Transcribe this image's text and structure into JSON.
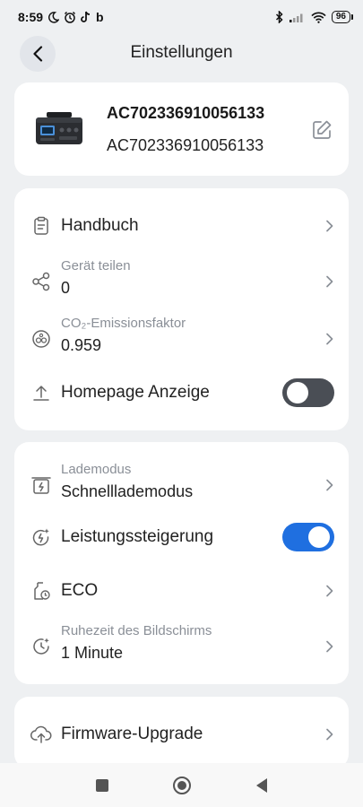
{
  "status_bar": {
    "time": "8:59",
    "notification_icons": [
      "moon-icon",
      "alarm-icon",
      "tiktok-icon",
      "b-icon"
    ],
    "b_label": "b",
    "battery": "96"
  },
  "header": {
    "title": "Einstellungen"
  },
  "device": {
    "name": "AC702336910056133",
    "serial": "AC702336910056133"
  },
  "section1": {
    "manual": {
      "title": "Handbuch"
    },
    "share": {
      "label": "Gerät teilen",
      "value": "0"
    },
    "co2": {
      "label": "CO₂-Emissionsfaktor",
      "value": "0.959"
    },
    "homepage": {
      "title": "Homepage Anzeige",
      "toggle": "off"
    }
  },
  "section2": {
    "charge_mode": {
      "label": "Lademodus",
      "value": "Schnelllademodus"
    },
    "boost": {
      "title": "Leistungssteigerung",
      "toggle": "on"
    },
    "eco": {
      "title": "ECO"
    },
    "screen_timeout": {
      "label": "Ruhezeit des Bildschirms",
      "value": "1 Minute"
    }
  },
  "section3": {
    "firmware": {
      "title": "Firmware-Upgrade"
    }
  },
  "colors": {
    "accent": "#1f6fe0",
    "toggle_off": "#4a4e55",
    "background": "#eef0f2"
  }
}
